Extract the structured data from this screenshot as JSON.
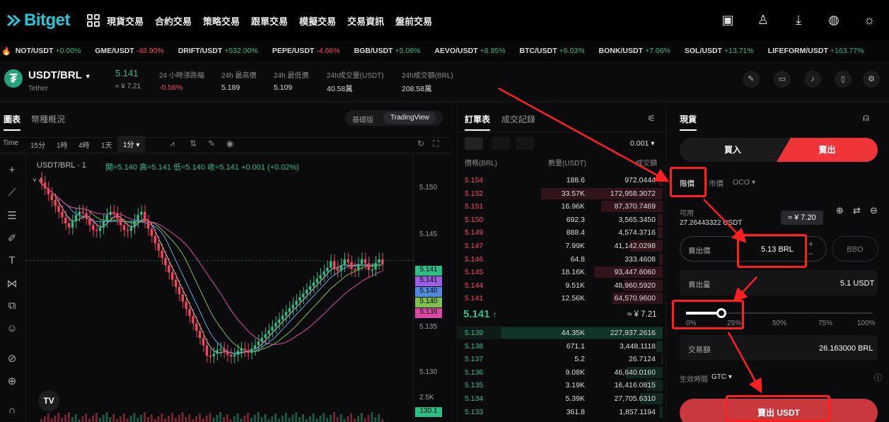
{
  "nav": {
    "brand": "Bitget",
    "menu": [
      "現貨交易",
      "合約交易",
      "策略交易",
      "跟單交易",
      "模擬交易",
      "交易資訊",
      "盤前交易"
    ],
    "icons": [
      "wallet-icon",
      "user-icon",
      "download-icon",
      "globe-icon",
      "sun-icon"
    ]
  },
  "ticker": [
    {
      "pair": "NOT/USDT",
      "chg": "+0.00%",
      "dir": "up"
    },
    {
      "pair": "GME/USDT",
      "chg": "-48.90%",
      "dir": "dn"
    },
    {
      "pair": "DRIFT/USDT",
      "chg": "+532.00%",
      "dir": "up"
    },
    {
      "pair": "PEPE/USDT",
      "chg": "-4.66%",
      "dir": "dn"
    },
    {
      "pair": "BGB/USDT",
      "chg": "+5.06%",
      "dir": "up"
    },
    {
      "pair": "AEVO/USDT",
      "chg": "+8.95%",
      "dir": "up"
    },
    {
      "pair": "BTC/USDT",
      "chg": "+6.03%",
      "dir": "up"
    },
    {
      "pair": "BONK/USDT",
      "chg": "+7.06%",
      "dir": "up"
    },
    {
      "pair": "SOL/USDT",
      "chg": "+13.71%",
      "dir": "up"
    },
    {
      "pair": "LIFEFORM/USDT",
      "chg": "+163.77%",
      "dir": "up"
    }
  ],
  "pair": {
    "symbol": "USDT/BRL",
    "name": "Tether",
    "price": "5.141",
    "price_fiat": "≈ ¥ 7.21",
    "change_label": "24 小時漲跌幅",
    "change": "-0.56%",
    "high_label": "24h 最高價",
    "high": "5.189",
    "low_label": "24h 最低價",
    "low": "5.109",
    "vol_label": "24h成交量(USDT)",
    "vol": "40.58萬",
    "amt_label": "24h成交額(BRL)",
    "amt": "208.58萬"
  },
  "chart": {
    "tab_chart": "圖表",
    "tab_info": "幣種概況",
    "mode_basic": "基礎版",
    "mode_tv": "TradingView",
    "intervals": [
      "Time",
      "15分",
      "1時",
      "4時",
      "1天",
      "1分"
    ],
    "legend_pair": "USDT/BRL · 1",
    "ohlc": "開=5.140  高=5.141  低=5.140  收=5.141  +0.001 (+0.02%)",
    "indicator_count": "4",
    "price_ticks": [
      "5.150",
      "5.145",
      "5.135",
      "5.130"
    ],
    "vol_tick": "2.5K",
    "vol_label": "130.1",
    "price_tags": [
      {
        "value": "5.141",
        "color": "#2ebd85"
      },
      {
        "value": "5.141",
        "color": "#9c5fe8"
      },
      {
        "value": "5.140",
        "color": "#4e8ad9"
      },
      {
        "value": "5.140",
        "color": "#7fbf4f"
      },
      {
        "value": "5.139",
        "color": "#d94aa8"
      }
    ],
    "tv_logo": "TV"
  },
  "book": {
    "tab_book": "訂單表",
    "tab_trades": "成交記錄",
    "precision": "0.001",
    "col_price": "價格(BRL)",
    "col_qty": "數量(USDT)",
    "col_total": "成交額",
    "asks": [
      {
        "p": "5.154",
        "q": "188.6",
        "t": "972.0444",
        "d": 0.02
      },
      {
        "p": "5.152",
        "q": "33.57K",
        "t": "172,958.3072",
        "d": 0.75
      },
      {
        "p": "5.151",
        "q": "16.96K",
        "t": "87,370.7469",
        "d": 0.38
      },
      {
        "p": "5.150",
        "q": "692.3",
        "t": "3,565.3450",
        "d": 0.03
      },
      {
        "p": "5.149",
        "q": "888.4",
        "t": "4,574.3716",
        "d": 0.03
      },
      {
        "p": "5.147",
        "q": "7.99K",
        "t": "41,142.0298",
        "d": 0.2
      },
      {
        "p": "5.146",
        "q": "64.8",
        "t": "333.4608",
        "d": 0.02
      },
      {
        "p": "5.145",
        "q": "18.16K",
        "t": "93,447.6060",
        "d": 0.42
      },
      {
        "p": "5.144",
        "q": "9.51K",
        "t": "48,960.5920",
        "d": 0.24
      },
      {
        "p": "5.141",
        "q": "12.56K",
        "t": "64,570.9600",
        "d": 0.31
      }
    ],
    "mid_price": "5.141",
    "mid_fiat": "≈ ¥ 7.21",
    "bids": [
      {
        "p": "5.139",
        "q": "44.35K",
        "t": "227,937.2616",
        "d": 0.99
      },
      {
        "p": "5.138",
        "q": "671.1",
        "t": "3,448.1118",
        "d": 0.04
      },
      {
        "p": "5.137",
        "q": "5.2",
        "t": "26.7124",
        "d": 0.01
      },
      {
        "p": "5.136",
        "q": "9.08K",
        "t": "46,640.0160",
        "d": 0.22
      },
      {
        "p": "5.135",
        "q": "3.19K",
        "t": "16,416.0815",
        "d": 0.1
      },
      {
        "p": "5.134",
        "q": "5.39K",
        "t": "27,705.6310",
        "d": 0.14
      },
      {
        "p": "5.133",
        "q": "361.8",
        "t": "1,857.1194",
        "d": 0.02
      }
    ]
  },
  "trade": {
    "title": "現貨",
    "buy": "買入",
    "sell": "賣出",
    "order_limit": "限價",
    "order_market": "市價",
    "order_oco": "OCO",
    "avail_label": "可用",
    "avail_value": "27.26443322 USDT",
    "tooltip": "≈ ¥ 7.20",
    "price_label": "賣出價",
    "price_value": "5.13 BRL",
    "bbo": "BBO",
    "amount_label": "賣出量",
    "amount_value": "5.1 USDT",
    "slider_fraction": 0.19,
    "slider_marks": [
      "0%",
      "25%",
      "50%",
      "75%",
      "100%"
    ],
    "total_label": "交易額",
    "total_value": "26.163000 BRL",
    "tif_label": "生效時間",
    "tif_value": "GTC",
    "submit": "賣出 USDT"
  }
}
